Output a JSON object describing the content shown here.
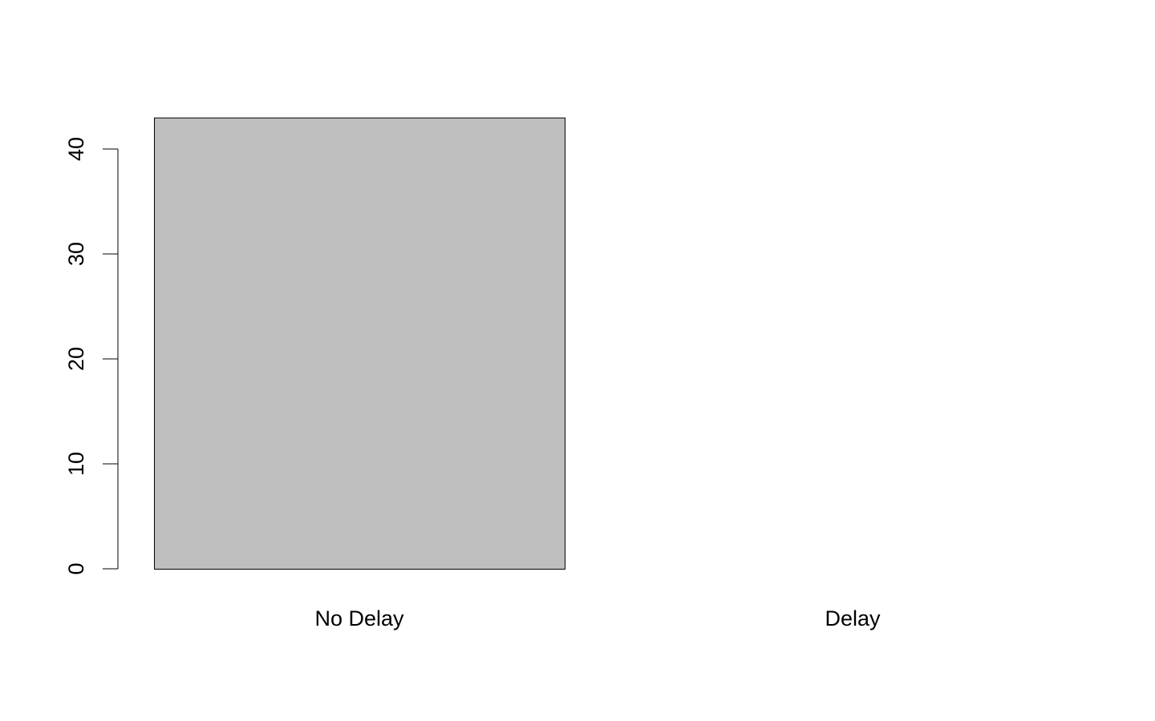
{
  "chart_data": {
    "type": "bar",
    "title": "",
    "xlabel": "",
    "ylabel": "",
    "categories": [
      "No Delay",
      "Delay"
    ],
    "values": [
      43,
      0
    ],
    "yticks": [
      0,
      10,
      20,
      30,
      40
    ],
    "ylim": [
      0,
      43
    ],
    "grid": false,
    "legend": "none",
    "colors": {
      "bar_fill": "#bebebe",
      "bar_stroke": "#000000",
      "axis": "#000000",
      "background": "#ffffff"
    }
  }
}
